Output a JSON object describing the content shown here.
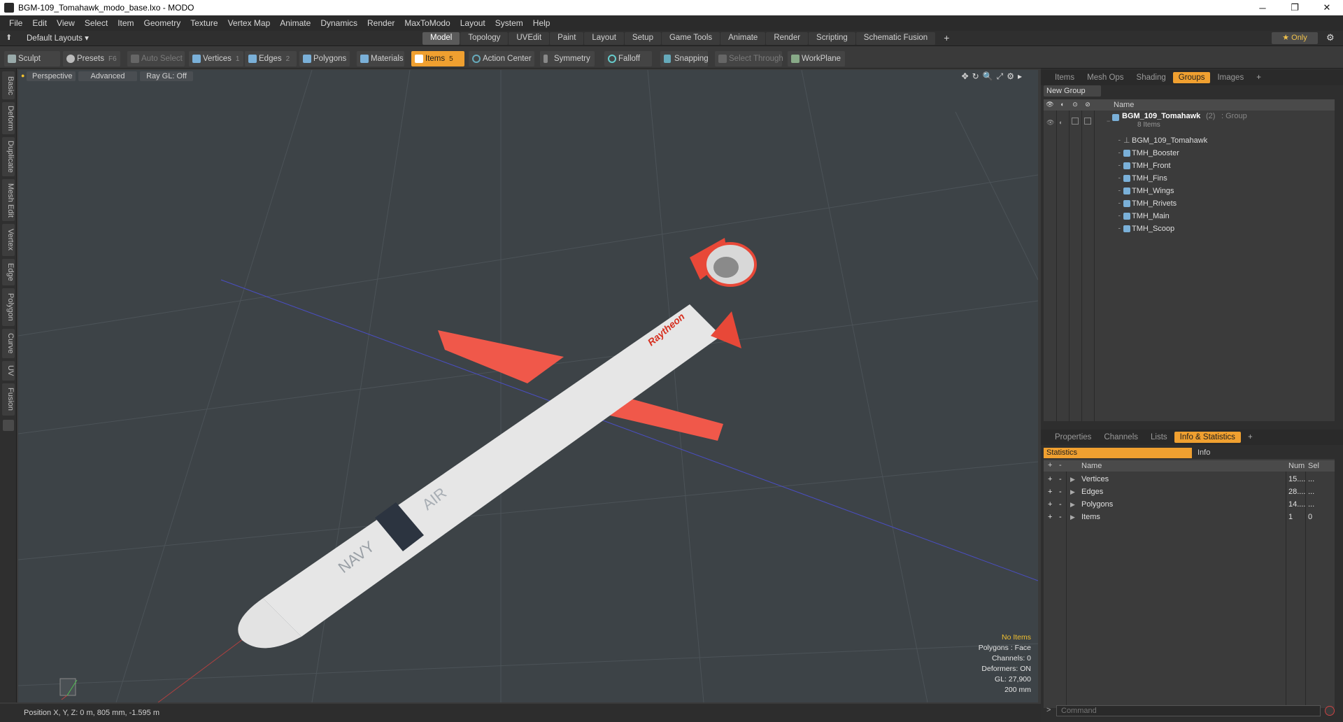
{
  "window": {
    "title": "BGM-109_Tomahawk_modo_base.lxo - MODO",
    "min": "─",
    "max": "❐",
    "close": "✕"
  },
  "menu": [
    "File",
    "Edit",
    "View",
    "Select",
    "Item",
    "Geometry",
    "Texture",
    "Vertex Map",
    "Animate",
    "Dynamics",
    "Render",
    "MaxToModo",
    "Layout",
    "System",
    "Help"
  ],
  "layoutbar": {
    "layouts_label": "Default Layouts ▾",
    "tabs": [
      "Model",
      "Topology",
      "UVEdit",
      "Paint",
      "Layout",
      "Setup",
      "Game Tools",
      "Animate",
      "Render",
      "Scripting",
      "Schematic Fusion"
    ],
    "active_tab": "Model",
    "plus": "+",
    "only": "★ Only",
    "gear": "⚙"
  },
  "toolbar": {
    "sculpt": "Sculpt",
    "presets": "Presets",
    "presets_key": "F6",
    "auto_select": "Auto Select",
    "vertices": "Vertices",
    "vertices_key": "1",
    "edges": "Edges",
    "edges_key": "2",
    "polygons": "Polygons",
    "materials": "Materials",
    "items": "Items",
    "items_key": "5",
    "action_center": "Action Center",
    "symmetry": "Symmetry",
    "falloff": "Falloff",
    "snapping": "Snapping",
    "select_through": "Select Through",
    "workplane": "WorkPlane"
  },
  "lefttabs": [
    "Basic",
    "Deform",
    "Duplicate",
    "Mesh Edit",
    "Vertex",
    "Edge",
    "Polygon",
    "Curve",
    "UV",
    "Fusion"
  ],
  "viewport": {
    "perspective": "Perspective",
    "advanced": "Advanced",
    "raygl": "Ray GL: Off",
    "icons": "✥↻🔍⤢⚙▸",
    "info": {
      "items": "No Items",
      "polygons": "Polygons : Face",
      "channels": "Channels: 0",
      "deformers": "Deformers: ON",
      "gl": "GL: 27,900",
      "scale": "200 mm"
    },
    "missile_texts": {
      "brand": "Raytheon",
      "navy": "NAVY",
      "air": "AIR"
    }
  },
  "status": {
    "position": "Position X, Y, Z:  0 m, 805 mm, -1.595 m"
  },
  "top_panel": {
    "tabs": [
      "Items",
      "Mesh Ops",
      "Shading",
      "Groups",
      "Images"
    ],
    "active_tab": "Groups",
    "plus": "+",
    "new_group": "New Group",
    "name_header": "Name",
    "group": {
      "name": "BGM_109_Tomahawk",
      "count": "(2)",
      "type": ": Group",
      "sub": "8 Items"
    },
    "items": [
      "BGM_109_Tomahawk",
      "TMH_Booster",
      "TMH_Front",
      "TMH_Fins",
      "TMH_Wings",
      "TMH_Rrivets",
      "TMH_Main",
      "TMH_Scoop"
    ]
  },
  "bottom_panel": {
    "tabs": [
      "Properties",
      "Channels",
      "Lists",
      "Info & Statistics"
    ],
    "active_tab": "Info & Statistics",
    "plus": "+",
    "subtabs": [
      "Statistics",
      "Info"
    ],
    "headers": {
      "name": "Name",
      "num": "Num",
      "sel": "Sel"
    },
    "rows": [
      {
        "name": "Vertices",
        "num": "15....",
        "sel": "..."
      },
      {
        "name": "Edges",
        "num": "28....",
        "sel": "..."
      },
      {
        "name": "Polygons",
        "num": "14....",
        "sel": "..."
      },
      {
        "name": "Items",
        "num": "1",
        "sel": "0"
      }
    ],
    "command_placeholder": "Command",
    "prompt": ">"
  },
  "colors": {
    "accent": "#f0a030",
    "missile_body": "#e8e8e8",
    "missile_red": "#f05040",
    "viewport_bg": "#3d4347"
  }
}
